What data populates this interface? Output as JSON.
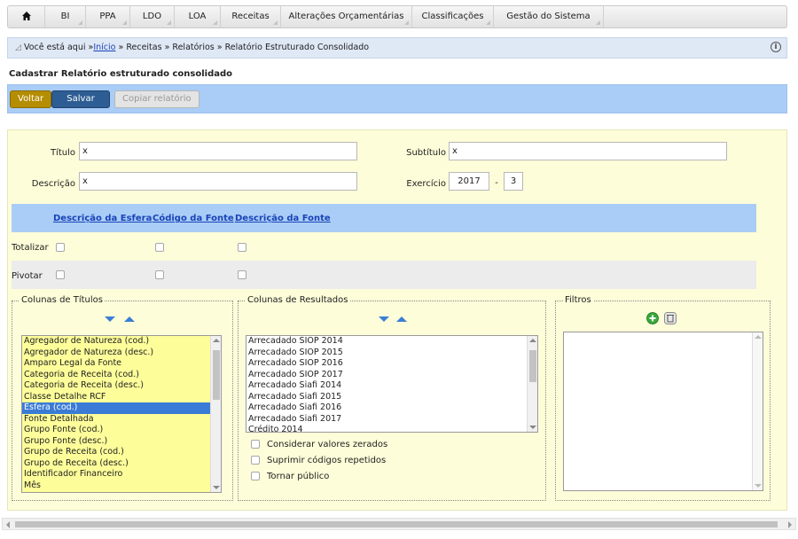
{
  "menu": {
    "home_icon": "home-icon",
    "items": [
      "BI",
      "PPA",
      "LDO",
      "LOA",
      "Receitas",
      "Alterações Orçamentárias",
      "Classificações",
      "Gestão do Sistema"
    ]
  },
  "breadcrumb": {
    "prefix": "Você está aqui »",
    "home": "Início",
    "rest": "» Receitas » Relatórios » Relatório Estruturado Consolidado",
    "info_icon": "info-icon"
  },
  "page_title": "Cadastrar Relatório estruturado consolidado",
  "toolbar": {
    "voltar": "Voltar",
    "salvar": "Salvar",
    "copiar": "Copiar relatório"
  },
  "form": {
    "titulo_label": "Título",
    "titulo_value": "x",
    "subtitulo_label": "Subtítulo",
    "subtitulo_value": "x",
    "descricao_label": "Descrição",
    "descricao_value": "x",
    "exercicio_label": "Exercício",
    "exercicio_ano": "2017",
    "exercicio_sep": "-",
    "exercicio_periodo": "3"
  },
  "grid": {
    "columns": [
      "Descrição da Esfera",
      "Código da Fonte",
      "Descrição da Fonte"
    ],
    "rows": [
      {
        "label": "Totalizar",
        "checks": [
          false,
          false,
          false
        ]
      },
      {
        "label": "Pivotar",
        "checks": [
          false,
          false,
          false
        ]
      }
    ]
  },
  "colunas_titulos": {
    "legend": "Colunas de Títulos",
    "items": [
      "Agregador de Natureza (cod.)",
      "Agregador de Natureza (desc.)",
      "Amparo Legal da Fonte",
      "Categoria de Receita (cod.)",
      "Categoria de Receita (desc.)",
      "Classe Detalhe RCF",
      "Esfera (cod.)",
      "Fonte Detalhada",
      "Grupo Fonte (cod.)",
      "Grupo Fonte (desc.)",
      "Grupo de Receita (cod.)",
      "Grupo de Receita (desc.)",
      "Identificador Financeiro",
      "Mês"
    ],
    "selected": "Esfera (cod.)"
  },
  "colunas_resultados": {
    "legend": "Colunas de Resultados",
    "items": [
      "Arrecadado SIOP 2014",
      "Arrecadado SIOP 2015",
      "Arrecadado SIOP 2016",
      "Arrecadado SIOP 2017",
      "Arrecadado Siafi 2014",
      "Arrecadado Siafi 2015",
      "Arrecadado Siafi 2016",
      "Arrecadado Siafi 2017",
      "Crédito 2014"
    ],
    "options": [
      "Considerar valores zerados",
      "Suprimir códigos repetidos",
      "Tornar público"
    ]
  },
  "filtros": {
    "legend": "Filtros",
    "add_icon": "add-circle-icon",
    "delete_icon": "trash-icon"
  },
  "colors": {
    "accent_blue": "#a9cdf6",
    "panel_yellow": "#fdfdd9",
    "list_yellow": "#fdfd9a",
    "selection_blue": "#3a7bd5",
    "voltar_gold": "#b58d00",
    "salvar_navy": "#2d5d92"
  }
}
